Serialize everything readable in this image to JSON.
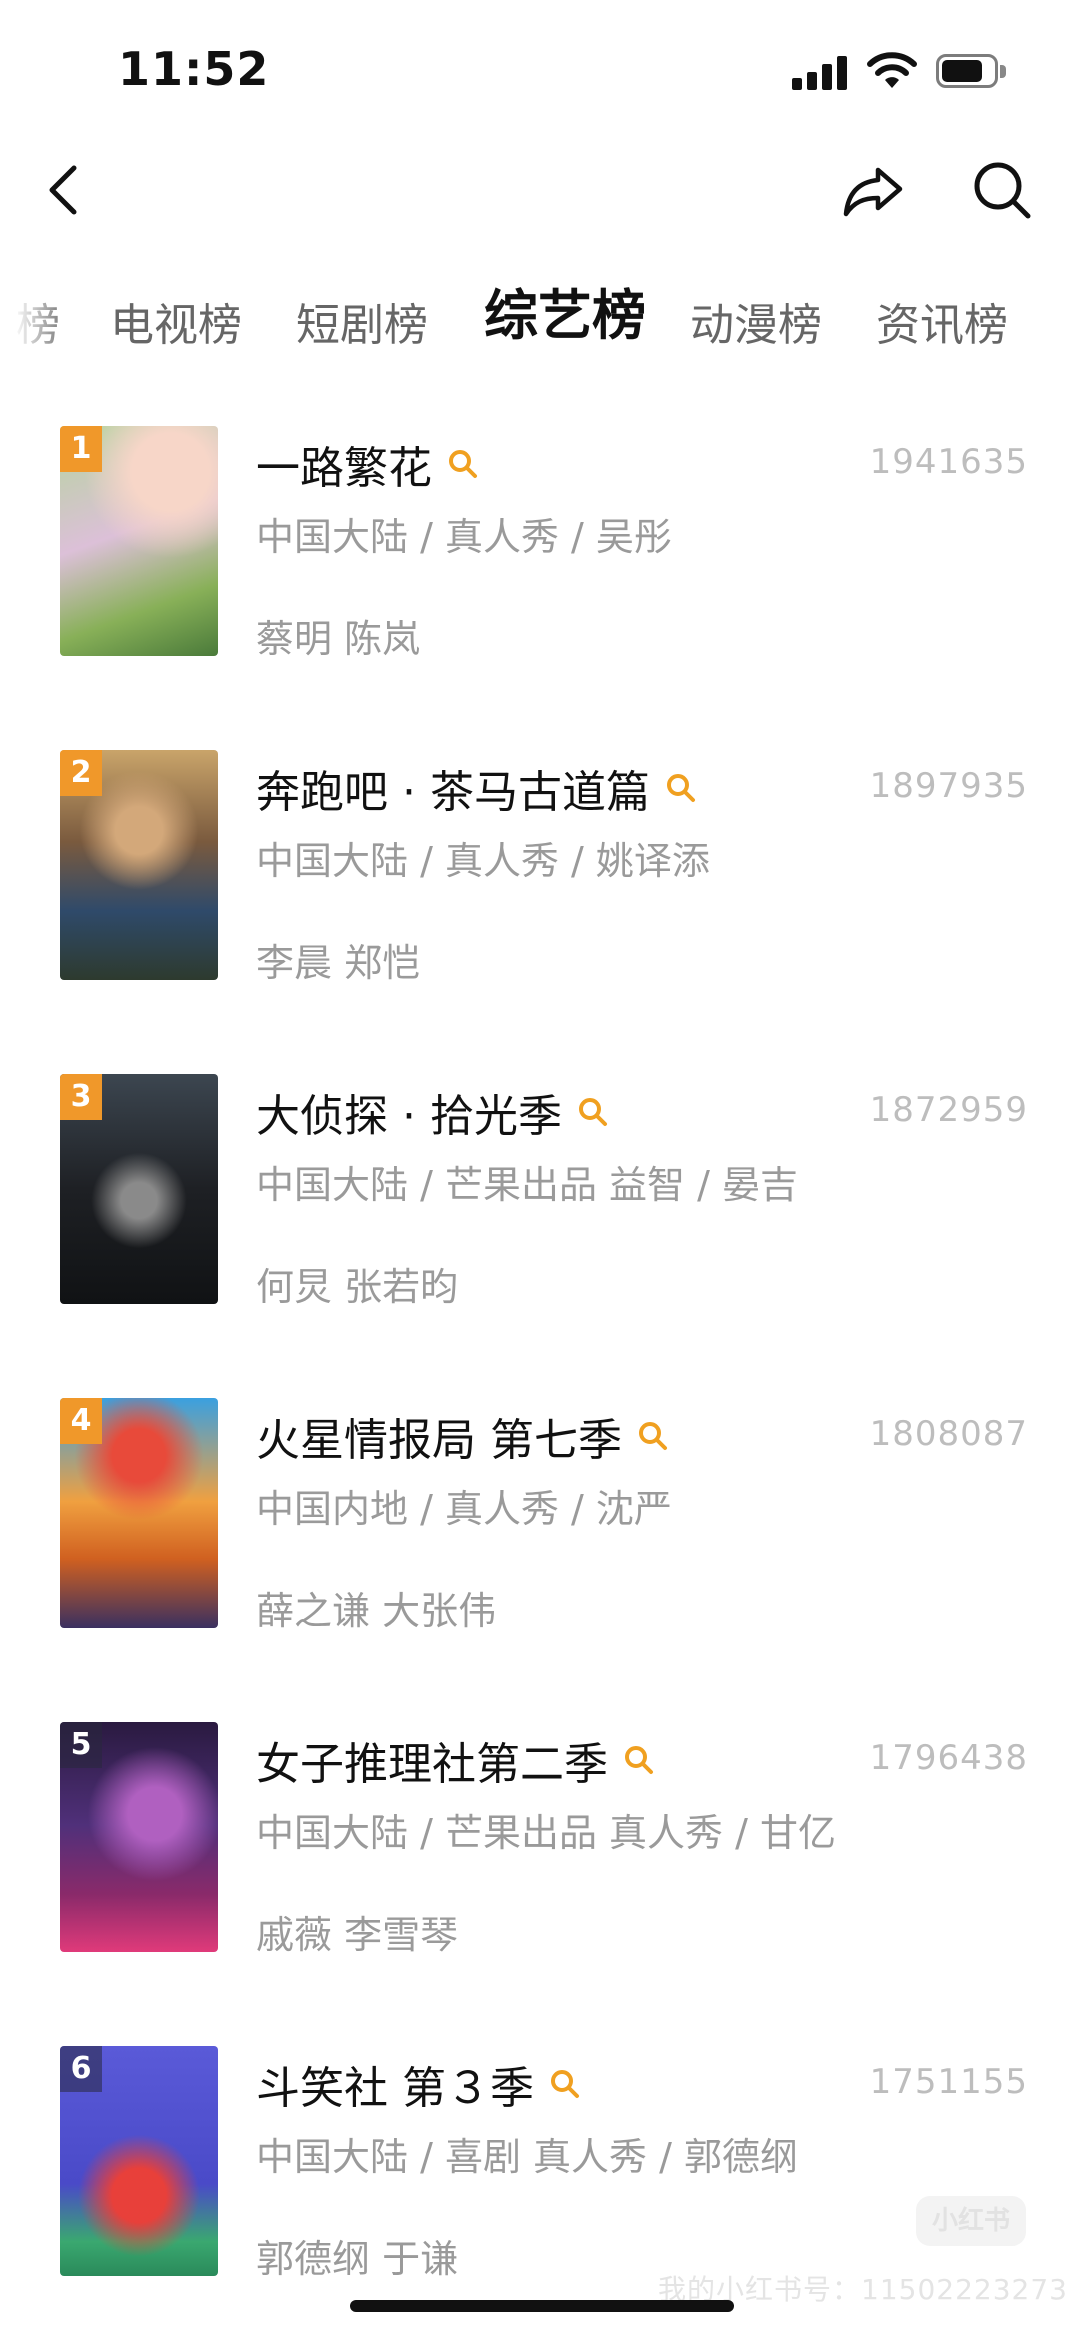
{
  "status_bar": {
    "time": "11:52"
  },
  "tabs": [
    {
      "label": "榜",
      "active": false
    },
    {
      "label": "电视榜",
      "active": false
    },
    {
      "label": "短剧榜",
      "active": false
    },
    {
      "label": "综艺榜",
      "active": true
    },
    {
      "label": "动漫榜",
      "active": false
    },
    {
      "label": "资讯榜",
      "active": false
    }
  ],
  "items": [
    {
      "rank": "1",
      "title": "一路繁花",
      "score": "1941635",
      "meta": "中国大陆 / 真人秀 / 吴彤",
      "cast": "蔡明 陈岚",
      "badge_color": "#f0982a"
    },
    {
      "rank": "2",
      "title": "奔跑吧 · 茶马古道篇",
      "score": "1897935",
      "meta": "中国大陆 / 真人秀 / 姚译添",
      "cast": "李晨 郑恺",
      "badge_color": "#f0982a"
    },
    {
      "rank": "3",
      "title": "大侦探 · 拾光季",
      "score": "1872959",
      "meta": "中国大陆 / 芒果出品 益智 / 晏吉",
      "cast": "何炅 张若昀",
      "badge_color": "#f0982a"
    },
    {
      "rank": "4",
      "title": "火星情报局 第七季",
      "score": "1808087",
      "meta": "中国内地 / 真人秀 / 沈严",
      "cast": "薛之谦 大张伟",
      "badge_color": "#f0982a"
    },
    {
      "rank": "5",
      "title": "女子推理社第二季",
      "score": "1796438",
      "meta": "中国大陆 / 芒果出品 真人秀 / 甘亿",
      "cast": "戚薇 李雪琴",
      "badge_color": "rgba(40,40,60,0.55)"
    },
    {
      "rank": "6",
      "title": "斗笑社 第３季",
      "score": "1751155",
      "meta": "中国大陆 / 喜剧 真人秀 / 郭德纲",
      "cast": "郭德纲 于谦",
      "badge_color": "rgba(40,40,60,0.55)"
    }
  ],
  "watermark": {
    "text": "我的小红书号：11502223273",
    "logo": "小红书"
  },
  "colors": {
    "accent": "#f0a020",
    "muted_text": "#9a9a9a",
    "score_text": "#bdbdbd"
  }
}
